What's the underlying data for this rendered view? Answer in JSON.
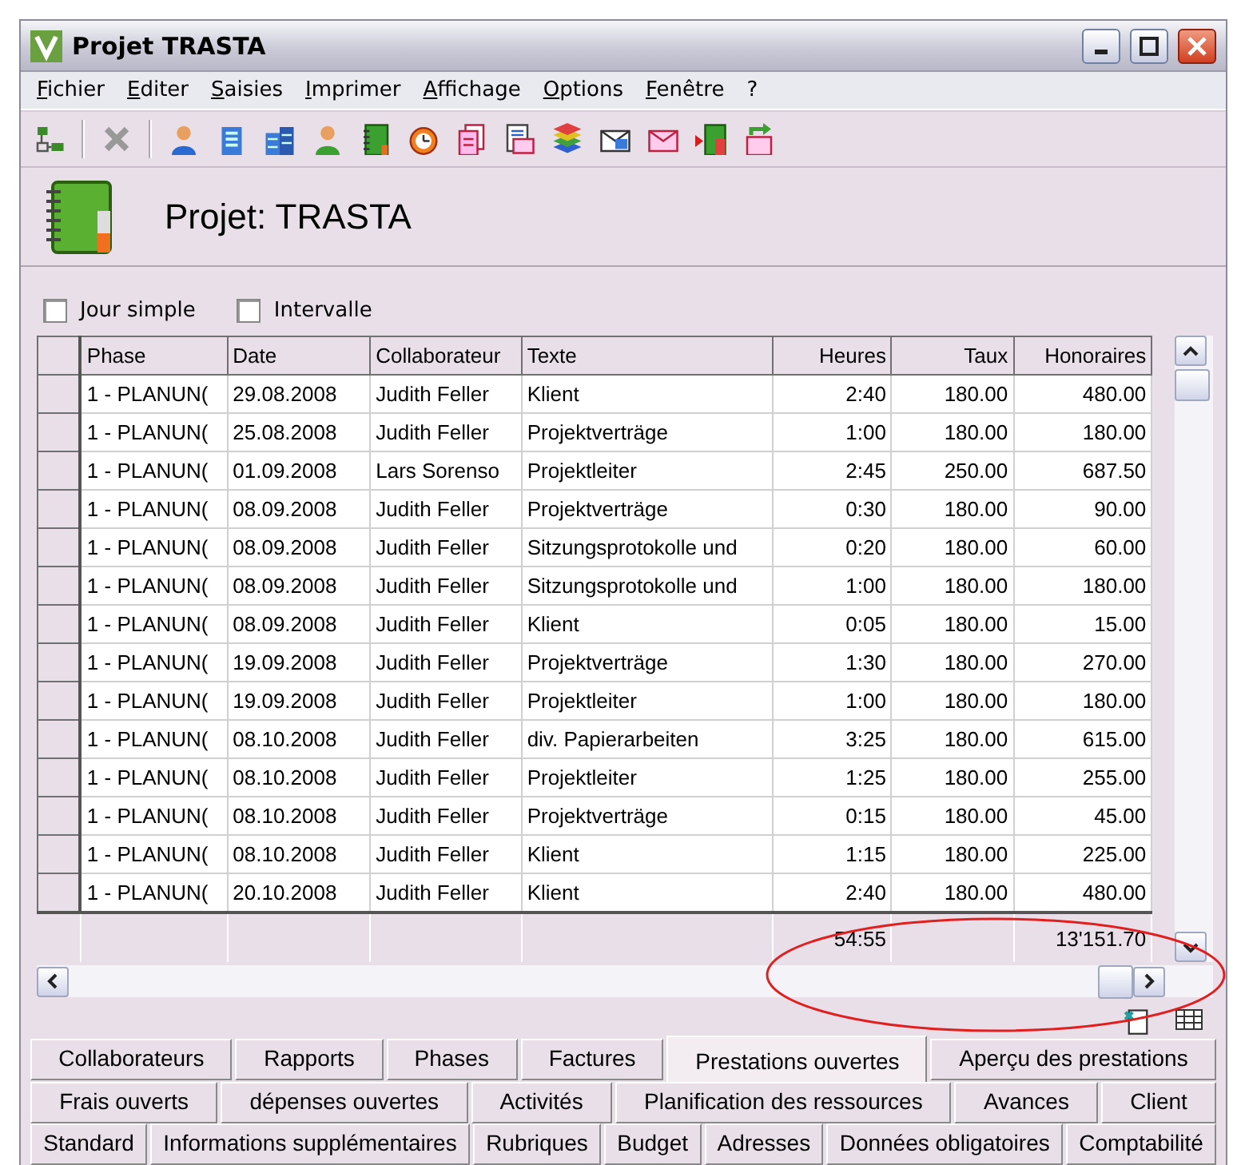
{
  "window": {
    "title": "Projet TRASTA"
  },
  "menu": [
    "Fichier",
    "Editer",
    "Saisies",
    "Imprimer",
    "Affichage",
    "Options",
    "Fenêtre",
    "?"
  ],
  "header": {
    "title": "Projet: TRASTA"
  },
  "filters": [
    {
      "label": "Jour simple",
      "checked": false
    },
    {
      "label": "Intervalle",
      "checked": false
    }
  ],
  "table": {
    "columns": [
      "Phase",
      "Date",
      "Collaborateur",
      "Texte",
      "Heures",
      "Taux",
      "Honoraires"
    ],
    "rows": [
      [
        "1 - PLANUN(",
        "29.08.2008",
        "Judith Feller",
        "Klient",
        "2:40",
        "180.00",
        "480.00"
      ],
      [
        "1 - PLANUN(",
        "25.08.2008",
        "Judith Feller",
        "Projektverträge",
        "1:00",
        "180.00",
        "180.00"
      ],
      [
        "1 - PLANUN(",
        "01.09.2008",
        "Lars Sorenso",
        "Projektleiter",
        "2:45",
        "250.00",
        "687.50"
      ],
      [
        "1 - PLANUN(",
        "08.09.2008",
        "Judith Feller",
        "Projektverträge",
        "0:30",
        "180.00",
        "90.00"
      ],
      [
        "1 - PLANUN(",
        "08.09.2008",
        "Judith Feller",
        "Sitzungsprotokolle und",
        "0:20",
        "180.00",
        "60.00"
      ],
      [
        "1 - PLANUN(",
        "08.09.2008",
        "Judith Feller",
        "Sitzungsprotokolle und",
        "1:00",
        "180.00",
        "180.00"
      ],
      [
        "1 - PLANUN(",
        "08.09.2008",
        "Judith Feller",
        "Klient",
        "0:05",
        "180.00",
        "15.00"
      ],
      [
        "1 - PLANUN(",
        "19.09.2008",
        "Judith Feller",
        "Projektverträge",
        "1:30",
        "180.00",
        "270.00"
      ],
      [
        "1 - PLANUN(",
        "19.09.2008",
        "Judith Feller",
        "Projektleiter",
        "1:00",
        "180.00",
        "180.00"
      ],
      [
        "1 - PLANUN(",
        "08.10.2008",
        "Judith Feller",
        "div. Papierarbeiten",
        "3:25",
        "180.00",
        "615.00"
      ],
      [
        "1 - PLANUN(",
        "08.10.2008",
        "Judith Feller",
        "Projektleiter",
        "1:25",
        "180.00",
        "255.00"
      ],
      [
        "1 - PLANUN(",
        "08.10.2008",
        "Judith Feller",
        "Projektverträge",
        "0:15",
        "180.00",
        "45.00"
      ],
      [
        "1 - PLANUN(",
        "08.10.2008",
        "Judith Feller",
        "Klient",
        "1:15",
        "180.00",
        "225.00"
      ],
      [
        "1 - PLANUN(",
        "20.10.2008",
        "Judith Feller",
        "Klient",
        "2:40",
        "180.00",
        "480.00"
      ]
    ],
    "totals": {
      "heures": "54:55",
      "honoraires": "13'151.70"
    }
  },
  "tabs": [
    [
      {
        "label": "Collaborateurs",
        "selected": false
      },
      {
        "label": "Rapports",
        "selected": false
      },
      {
        "label": "Phases",
        "selected": false
      },
      {
        "label": "Factures",
        "selected": false
      },
      {
        "label": "Prestations ouvertes",
        "selected": true
      },
      {
        "label": "Aperçu des prestations",
        "selected": false
      }
    ],
    [
      {
        "label": "Frais ouverts",
        "selected": false
      },
      {
        "label": "dépenses ouvertes",
        "selected": false
      },
      {
        "label": "Activités",
        "selected": false
      },
      {
        "label": "Planification des ressources",
        "selected": false
      },
      {
        "label": "Avances",
        "selected": false
      },
      {
        "label": "Client",
        "selected": false
      }
    ],
    [
      {
        "label": "Standard",
        "selected": false
      },
      {
        "label": "Informations supplémentaires",
        "selected": false
      },
      {
        "label": "Rubriques",
        "selected": false
      },
      {
        "label": "Budget",
        "selected": false
      },
      {
        "label": "Adresses",
        "selected": false
      },
      {
        "label": "Données obligatoires",
        "selected": false
      },
      {
        "label": "Comptabilité",
        "selected": false
      }
    ]
  ]
}
